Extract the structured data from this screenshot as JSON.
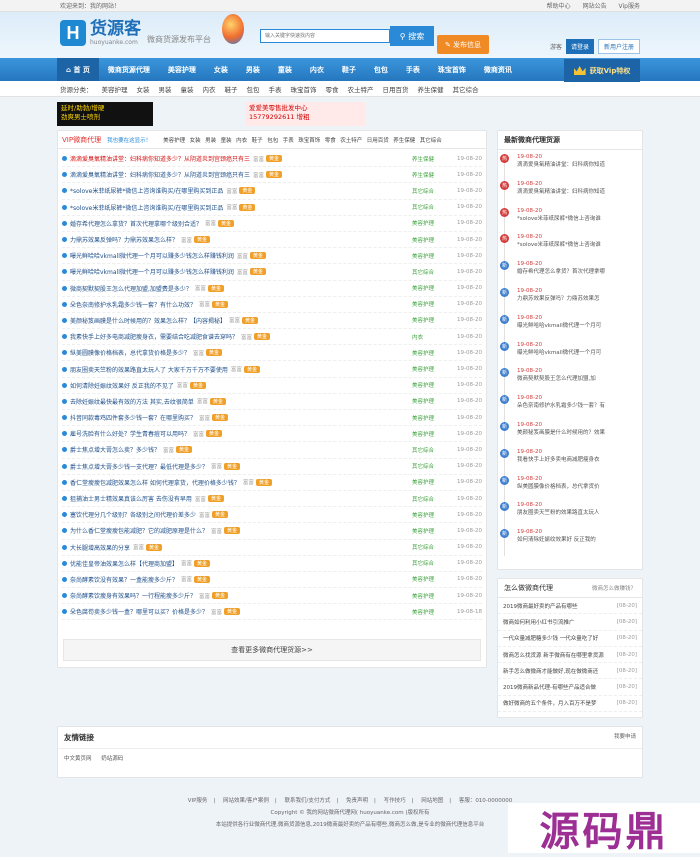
{
  "topbar": {
    "welcome": "欢迎来到：我的网站！",
    "links": [
      "帮助中心",
      "网站公告",
      "Vip服务"
    ]
  },
  "logo": {
    "title": "货源客",
    "domain": "huoyuanke.com",
    "slogan": "微商货源发布平台"
  },
  "search": {
    "placeholder": "输入关键字快速找内容",
    "button": "搜索",
    "publish": "发布信息"
  },
  "login": {
    "visitor": "游客",
    "login": "请登录",
    "register": "新用户注册"
  },
  "nav": {
    "items": [
      "首 页",
      "微商货源代理",
      "美容护理",
      "女装",
      "男装",
      "童装",
      "内衣",
      "鞋子",
      "包包",
      "手表",
      "珠宝首饰",
      "微商资讯"
    ],
    "vip": "获取Vip特权"
  },
  "subnav": {
    "label": "货源分类：",
    "items": [
      "美容护理",
      "女装",
      "男装",
      "童装",
      "内衣",
      "鞋子",
      "包包",
      "手表",
      "珠宝首饰",
      "零食",
      "农土特产",
      "日用百货",
      "养生保健",
      "其它综合"
    ]
  },
  "banners": {
    "b1": [
      "延时/助勃/增硬",
      "劲爽男士喷剂"
    ],
    "b2": [
      "爱爱美零售批发中心",
      "15779292611 增粗"
    ]
  },
  "main": {
    "tab_title": "VIP微商代理",
    "tab_note": "我也要在这显示！",
    "cats": [
      "美容护理",
      "女装",
      "男装",
      "童装",
      "内衣",
      "鞋子",
      "包包",
      "手表",
      "珠宝首饰",
      "零食",
      "农土特产",
      "日用百货",
      "养生保健",
      "其它综合"
    ],
    "rows": [
      {
        "t": "滴滴爱臭氧精油讲堂：妇科病你知道多少？从阴道炎到宫颈癌只有三",
        "red": true,
        "c": "养生保健",
        "d": "19-08-20"
      },
      {
        "t": "滴滴爱臭氧精油讲堂：妇科病你知道多少？从阴道炎到宫颈癌只有三",
        "red": false,
        "c": "养生保健",
        "d": "19-08-20"
      },
      {
        "t": "*solove米菲纸尿裤*微信上咨询谁购买/在哪里购买到正品",
        "red": false,
        "c": "其它综合",
        "d": "19-08-20"
      },
      {
        "t": "*solove米菲纸尿裤*微信上咨询谁购买/在哪里购买到正品",
        "red": false,
        "c": "其它综合",
        "d": "19-08-20"
      },
      {
        "t": "婚存希代理怎么拿货？首次代理拿哪个级别合适？",
        "red": false,
        "c": "美容护理",
        "d": "19-08-20"
      },
      {
        "t": "力鼎苏效果反弹吗？力鼎苏效果怎么样？",
        "red": false,
        "c": "美容护理",
        "d": "19-08-20"
      },
      {
        "t": "曝光鲜哈哈vkmall微代理一个月可以赚多少钱怎么样赚钱利润",
        "red": false,
        "c": "美容护理",
        "d": "19-08-20"
      },
      {
        "t": "曝光鲜哈哈vkmall微代理一个月可以赚多少钱怎么样赚钱利润",
        "red": false,
        "c": "其它综合",
        "d": "19-08-20"
      },
      {
        "t": "微商契默契股王怎么代理加盟,加盟费是多少？",
        "red": false,
        "c": "美容护理",
        "d": "19-08-20"
      },
      {
        "t": "朵色奈南修护水乳霜多少钱一套？有什么功效？",
        "red": false,
        "c": "美容护理",
        "d": "19-08-20"
      },
      {
        "t": "美颜秘笈画膜是什么时候用的？效果怎么样？【内容揭秘】",
        "red": false,
        "c": "美容护理",
        "d": "19-08-20"
      },
      {
        "t": "我素快手上好多电商减肥瘦身衣，需要结合吃减肥食谱去穿吗？",
        "red": false,
        "c": "内衣",
        "d": "19-08-20"
      },
      {
        "t": "纵美圆膜像价格档表，总代拿货价格是多少？",
        "red": false,
        "c": "美容护理",
        "d": "19-08-20"
      },
      {
        "t": "朋友圈卖天竺粉的效果路直太玩人了 大家千万千万不要使用",
        "red": false,
        "c": "美容护理",
        "d": "19-08-20"
      },
      {
        "t": "如何清除妊娠纹效果好 反正我的不见了",
        "red": false,
        "c": "美容护理",
        "d": "19-08-20"
      },
      {
        "t": "去除妊娠纹最快最有效的方法 其实,去纹很简单",
        "red": false,
        "c": "美容护理",
        "d": "19-08-20"
      },
      {
        "t": "抖音同款毒鸡四件套多少钱一套？在哪里购买？",
        "red": false,
        "c": "美容护理",
        "d": "19-08-20"
      },
      {
        "t": "雇号洗脸有什么好处？学生青春痘可以用吗？",
        "red": false,
        "c": "美容护理",
        "d": "19-08-20"
      },
      {
        "t": "爵士焦点增大膏怎么卖？多少钱？",
        "red": false,
        "c": "其它综合",
        "d": "19-08-20"
      },
      {
        "t": "爵士焦点增大膏多少钱一支代理？最低代理是多少？",
        "red": false,
        "c": "其它综合",
        "d": "19-08-20"
      },
      {
        "t": "香仁堂瘦瘦包减肥效果怎么样 如何代理拿货，代理价格多少钱？",
        "red": false,
        "c": "美容护理",
        "d": "19-08-20"
      },
      {
        "t": "狙捕油士男士精效果真该么厉害 去伤没有早用",
        "red": false,
        "c": "其它综合",
        "d": "19-08-20"
      },
      {
        "t": "塞饮代理分几个级别？各级别之间代理价差多少",
        "red": false,
        "c": "美容护理",
        "d": "19-08-20"
      },
      {
        "t": "为什么香仁堂瘦瘦包能减肥？它的减肥原理是什么？",
        "red": false,
        "c": "美容护理",
        "d": "19-08-20"
      },
      {
        "t": "大长腿增高效果的分享",
        "red": false,
        "c": "其它综合",
        "d": "19-08-20"
      },
      {
        "t": "优能佳皇帝油效果怎么样【代理商加盟】",
        "red": false,
        "c": "其它综合",
        "d": "19-08-20"
      },
      {
        "t": "奈尚酵素饮没有效果？一盒能瘦多少斤？",
        "red": false,
        "c": "美容护理",
        "d": "19-08-20"
      },
      {
        "t": "奈尚酵素饮瘦身有效果吗？一行程能瘦多少斤？",
        "red": false,
        "c": "美容护理",
        "d": "19-08-20"
      },
      {
        "t": "朵色腐苟卖多少钱一盒？哪里可以买？价格是多少？",
        "red": false,
        "c": "美容护理",
        "d": "19-08-18"
      }
    ],
    "tag1": "富富",
    "tag2": "黄金",
    "more": "查看更多微商代理货源>>"
  },
  "side": {
    "title": "最新微商代理货源",
    "items": [
      {
        "d": "19-08-20",
        "x": "滴滴爱臭氧精油讲堂：妇科病你知道"
      },
      {
        "d": "19-08-20",
        "x": "滴滴爱臭氧精油讲堂：妇科病你知道"
      },
      {
        "d": "19-08-20",
        "x": "*solove米菲纸尿裤*微信上咨询谁"
      },
      {
        "d": "19-08-20",
        "x": "*solove米菲纸尿裤*微信上咨询谁"
      },
      {
        "d": "19-08-20",
        "x": "婚存希代理怎么拿货？首次代理拿哪"
      },
      {
        "d": "19-08-20",
        "x": "力鼎苏效果反弹吗？力鼎苏效果怎"
      },
      {
        "d": "19-08-20",
        "x": "曝光鲜哈哈vkmall微代理一个月可"
      },
      {
        "d": "19-08-20",
        "x": "曝光鲜哈哈vkmall微代理一个月可"
      },
      {
        "d": "19-08-20",
        "x": "微商契默契股王怎么代理加盟,加"
      },
      {
        "d": "19-08-20",
        "x": "朵色奈南修护水乳霜多少钱一套？有"
      },
      {
        "d": "19-08-20",
        "x": "美颜秘笈画膜是什么时候用的？效果"
      },
      {
        "d": "19-08-20",
        "x": "我看快手上好多卖电商减肥瘦身衣"
      },
      {
        "d": "19-08-20",
        "x": "纵美圆膜像价格档表，总代拿货价"
      },
      {
        "d": "19-08-20",
        "x": "朋友圈卖天竺粉的效果路直太玩人"
      },
      {
        "d": "19-08-20",
        "x": "如何清除妊娠纹效果好 反正我的"
      }
    ]
  },
  "side2": {
    "title": "怎么做微商代理",
    "more": "微商怎么做赚钱？",
    "items": [
      {
        "a": "2019微商最好卖的产品有哪些",
        "b": "[08-20]"
      },
      {
        "a": "微商如何利用小红书引流推广",
        "b": "[08-20]"
      },
      {
        "a": "一代众量减肥糖多少钱 一代众量吃了好",
        "b": "[08-20]"
      },
      {
        "a": "微商怎么找货源 新手微商有在哪里拿货源",
        "b": "[08-20]"
      },
      {
        "a": "新手怎么做微商才能做好,现在做微商还",
        "b": "[08-20]"
      },
      {
        "a": "2019微商新品代理-有哪些产品适合做",
        "b": "[08-20]"
      },
      {
        "a": "做好微商的五个条件，月入百万不是梦",
        "b": "[08-20]"
      }
    ]
  },
  "friend": {
    "title": "友情链接",
    "apply": "我要申请",
    "links": [
      "中文黄页网",
      "奶站源码"
    ]
  },
  "footer": {
    "links": [
      "VIP服务",
      "网站效果/客户案例",
      "联系我们/支付方式",
      "免责声明",
      "写作技巧",
      "网站地图",
      "客服：010-0000000"
    ],
    "copyright": "Copyright © 我的网站微商代理网( huoyuanke.com )版权所有",
    "desc": "本站提供各行业微商代理,微商货源信息,2019微商最好卖的产品有哪些,微商怎么做,是专业的微商代理信息平台"
  },
  "watermark": "源码鼎"
}
